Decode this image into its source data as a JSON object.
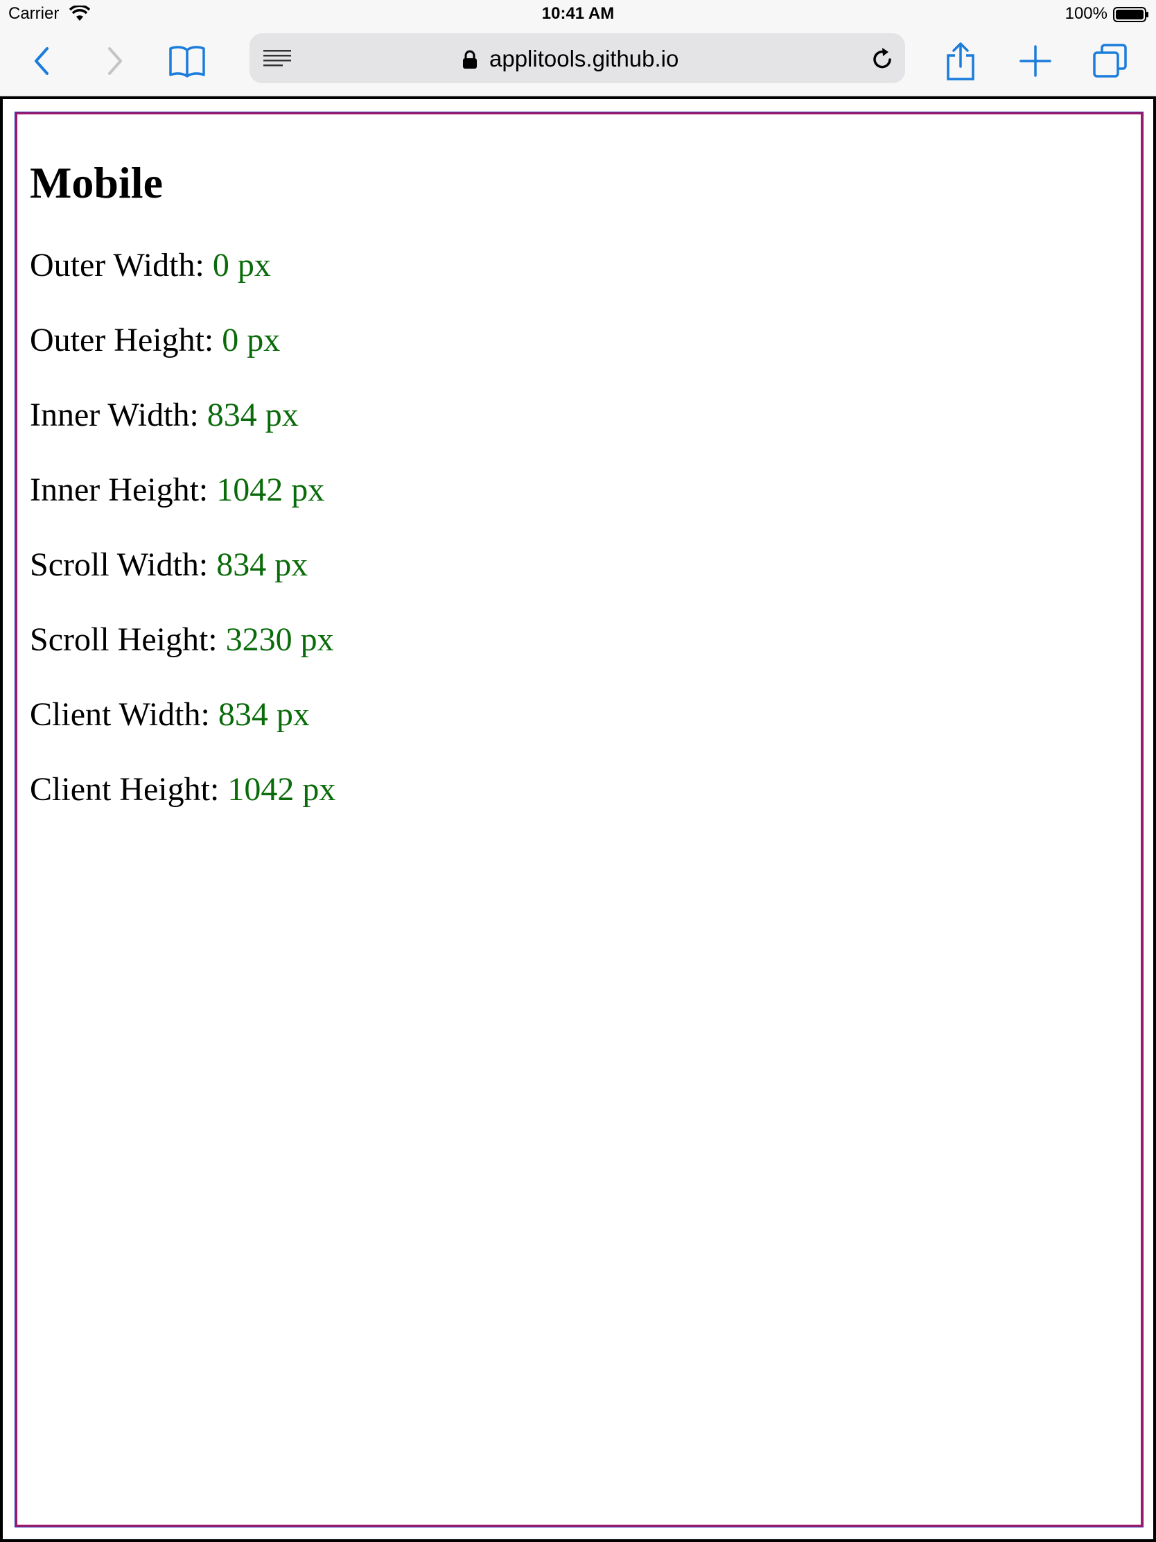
{
  "status_bar": {
    "carrier": "Carrier",
    "time": "10:41 AM",
    "battery": "100%"
  },
  "toolbar": {
    "url": "applitools.github.io",
    "accent_color": "#1a7cdb"
  },
  "page": {
    "title": "Mobile",
    "metrics": [
      {
        "label": "Outer Width:",
        "value": "0 px"
      },
      {
        "label": "Outer Height:",
        "value": "0 px"
      },
      {
        "label": "Inner Width:",
        "value": "834 px"
      },
      {
        "label": "Inner Height:",
        "value": "1042 px"
      },
      {
        "label": "Scroll Width:",
        "value": "834 px"
      },
      {
        "label": "Scroll Height:",
        "value": "3230 px"
      },
      {
        "label": "Client Width:",
        "value": "834 px"
      },
      {
        "label": "Client Height:",
        "value": "1042 px"
      }
    ],
    "value_color": "#0a6b0a"
  }
}
